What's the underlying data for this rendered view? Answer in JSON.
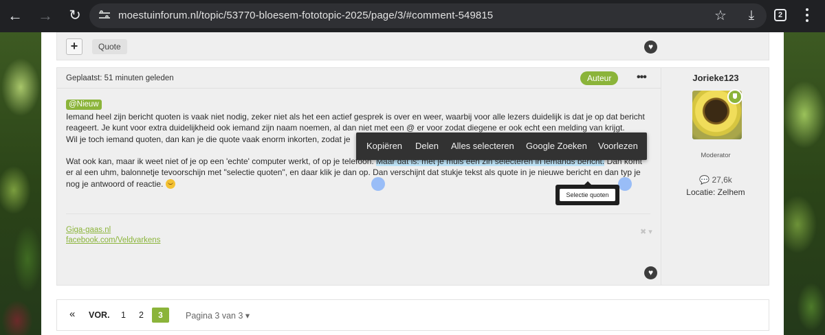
{
  "browser": {
    "url": "moestuinforum.nl/topic/53770-bloesem-fototopic-2025/page/3/#comment-549815",
    "tab_count": "2",
    "icons": [
      "back-arrow-icon",
      "forward-arrow-icon",
      "reload-icon",
      "site-info-icon",
      "star-icon",
      "download-icon",
      "tabs-icon",
      "more-vert-icon"
    ]
  },
  "prev_post": {
    "plus_label": "+",
    "quote_label": "Quote"
  },
  "post": {
    "posted": "Geplaatst: 51 minuten geleden",
    "author_badge": "Auteur",
    "menu_dots": "•••",
    "mention": "@Nieuw",
    "para1": "Iemand heel zijn bericht quoten is vaak niet nodig, zeker niet als het een actief gesprek is over en weer, waarbij voor alle lezers duidelijk is dat je op dat bericht reageert. Je kunt voor extra duidelijkheid ook iemand zijn naam noemen, al dan niet met een @ er voor zodat diegene er ook echt een melding van krijgt.",
    "para2": "Wil je toch iemand quoten, dan kan je die quote vaak enorm inkorten, zodat je",
    "para3_before": "Wat ook kan, maar ik weet niet of je op een 'echte' computer werkt, of op je telefoon.",
    "para3_selected": "Maar dat is: met je muis een zin selecteren in iemands bericht.",
    "para3_after": "Dan komt er al een uhm, balonnetje tevoorschijn met \"selectie quoten\", en daar klik je dan op. Dan verschijnt dat stukje tekst als quote in je nieuwe bericht en dan typ je nog je antwoord of reactie.",
    "sig_link1": "Giga-gaas.nl",
    "sig_link2": "facebook.com/Veldvarkens",
    "sig_ctrl": "✖ ▾"
  },
  "author": {
    "name": "Jorieke123",
    "role": "Moderator",
    "posts_count": "💬 27,6k",
    "location": "Locatie: Zelhem",
    "badge_color": "#8bb43a"
  },
  "context_menu": {
    "items": [
      "Kopiëren",
      "Delen",
      "Alles selecteren",
      "Google Zoeken",
      "Voorlezen"
    ]
  },
  "selection_popup": {
    "label": "Selectie quoten"
  },
  "pagination": {
    "first": "«",
    "prev": "VOR.",
    "pages": [
      "1",
      "2"
    ],
    "current": "3",
    "info": "Pagina 3 van 3 ▾"
  },
  "colors": {
    "accent_green": "#8bb43a",
    "selection_blue": "#bde3f7",
    "browser_bar": "#202124"
  }
}
